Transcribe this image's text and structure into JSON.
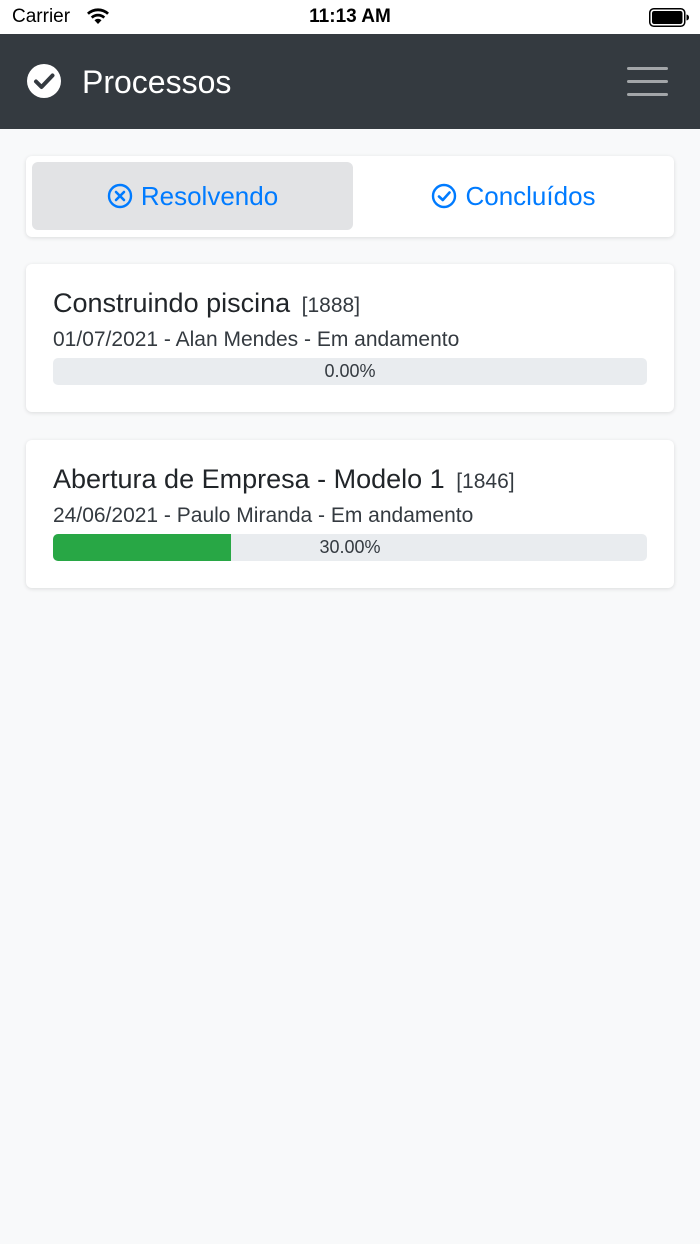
{
  "status_bar": {
    "carrier": "Carrier",
    "time": "11:13 AM",
    "wifi_icon": "wifi-icon",
    "battery_icon": "battery-icon"
  },
  "navbar": {
    "title": "Processos",
    "brand_icon": "check-circle-icon",
    "menu_icon": "hamburger-menu-icon",
    "background": "#343a40"
  },
  "tabs": [
    {
      "label": "Resolvendo",
      "icon": "x-circle-icon",
      "active": true
    },
    {
      "label": "Concluídos",
      "icon": "check-circle-outline-icon",
      "active": false
    }
  ],
  "processes": [
    {
      "title": "Construindo piscina",
      "id": "[1888]",
      "meta": "01/07/2021 - Alan Mendes - Em andamento",
      "progress": 0.0,
      "progress_label": "0.00%"
    },
    {
      "title": "Abertura de Empresa - Modelo 1",
      "id": "[1846]",
      "meta": "24/06/2021 - Paulo Miranda - Em andamento",
      "progress": 0.3,
      "progress_label": "30.00%"
    }
  ],
  "colors": {
    "accent": "#007bff",
    "progress_fill": "#28a745",
    "progress_track": "#e9ecef",
    "page_background": "#f8f9fa"
  }
}
